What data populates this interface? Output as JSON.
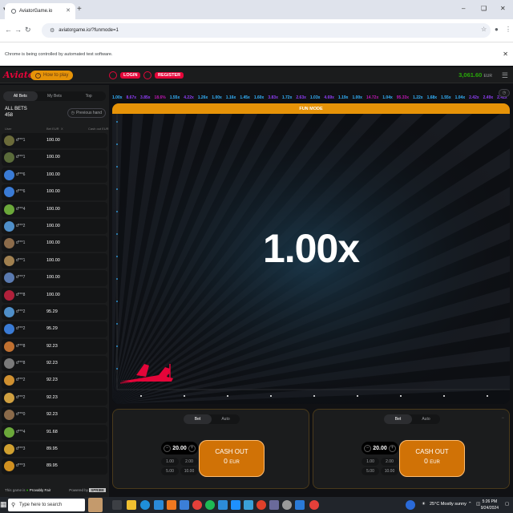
{
  "browser": {
    "tab_title": "AviatorGame.io",
    "url": "aviatorgame.io/?funmode=1",
    "automation_notice": "Chrome is being controlled by automated test software."
  },
  "header": {
    "logo": "Aviator",
    "how_to_play": "How to play",
    "login": "LOGIN",
    "register": "REGISTER",
    "balance": "3,061.60",
    "currency": "EUR"
  },
  "bets_panel": {
    "tabs": [
      "All Bets",
      "My Bets",
      "Top"
    ],
    "all_bets_label": "ALL BETS",
    "all_bets_count": "458",
    "previous_hand": "Previous hand",
    "col_user": "User",
    "col_bet": "Bet EUR",
    "col_x": "X",
    "col_cashout": "Cash out EUR",
    "rows": [
      {
        "name": "d***1",
        "amount": "100.00",
        "color": "#6b6b3a"
      },
      {
        "name": "d***1",
        "amount": "100.00",
        "color": "#5a6b3a"
      },
      {
        "name": "d***6",
        "amount": "100.00",
        "color": "#3a7bd5"
      },
      {
        "name": "d***6",
        "amount": "100.00",
        "color": "#3a7bd5"
      },
      {
        "name": "d***4",
        "amount": "100.00",
        "color": "#6ba83a"
      },
      {
        "name": "d***2",
        "amount": "100.00",
        "color": "#4f8fc9"
      },
      {
        "name": "d***1",
        "amount": "100.00",
        "color": "#8b6b4a"
      },
      {
        "name": "d***1",
        "amount": "100.00",
        "color": "#a08050"
      },
      {
        "name": "d***7",
        "amount": "100.00",
        "color": "#5a7ab0"
      },
      {
        "name": "d***8",
        "amount": "100.00",
        "color": "#b0203a"
      },
      {
        "name": "d***2",
        "amount": "95.29",
        "color": "#4f8fc9"
      },
      {
        "name": "d***2",
        "amount": "95.29",
        "color": "#3a7bd5"
      },
      {
        "name": "d***8",
        "amount": "92.23",
        "color": "#c07030"
      },
      {
        "name": "d***8",
        "amount": "92.23",
        "color": "#7a7a7a"
      },
      {
        "name": "d***2",
        "amount": "92.23",
        "color": "#d09030"
      },
      {
        "name": "d***2",
        "amount": "92.23",
        "color": "#d0a040"
      },
      {
        "name": "d***0",
        "amount": "92.23",
        "color": "#8a6a4a"
      },
      {
        "name": "d***4",
        "amount": "91.68",
        "color": "#6ba83a"
      },
      {
        "name": "d***3",
        "amount": "89.95",
        "color": "#d0a030"
      },
      {
        "name": "d***3",
        "amount": "89.95",
        "color": "#d09020"
      }
    ],
    "footer_provably": "This game is",
    "footer_provably_fair": "Provably Fair",
    "footer_powered": "Powered by",
    "footer_brand": "SPRIBE"
  },
  "history": [
    {
      "v": "1.00x",
      "c": "#34b4ff"
    },
    {
      "v": "8.67x",
      "c": "#913ef8"
    },
    {
      "v": "3.85x",
      "c": "#913ef8"
    },
    {
      "v": "18.6%",
      "c": "#c017b4"
    },
    {
      "v": "1.55x",
      "c": "#34b4ff"
    },
    {
      "v": "4.22x",
      "c": "#913ef8"
    },
    {
      "v": "1.26x",
      "c": "#34b4ff"
    },
    {
      "v": "1.00x",
      "c": "#34b4ff"
    },
    {
      "v": "1.16x",
      "c": "#34b4ff"
    },
    {
      "v": "1.45x",
      "c": "#34b4ff"
    },
    {
      "v": "1.60x",
      "c": "#34b4ff"
    },
    {
      "v": "3.83x",
      "c": "#913ef8"
    },
    {
      "v": "1.72x",
      "c": "#34b4ff"
    },
    {
      "v": "2.63x",
      "c": "#913ef8"
    },
    {
      "v": "1.03x",
      "c": "#34b4ff"
    },
    {
      "v": "4.69x",
      "c": "#913ef8"
    },
    {
      "v": "1.19x",
      "c": "#34b4ff"
    },
    {
      "v": "1.00x",
      "c": "#34b4ff"
    },
    {
      "v": "14.72x",
      "c": "#c017b4"
    },
    {
      "v": "1.04x",
      "c": "#34b4ff"
    },
    {
      "v": "95.33x",
      "c": "#c017b4"
    },
    {
      "v": "1.22x",
      "c": "#34b4ff"
    },
    {
      "v": "1.68x",
      "c": "#34b4ff"
    },
    {
      "v": "1.55x",
      "c": "#34b4ff"
    },
    {
      "v": "1.04x",
      "c": "#34b4ff"
    },
    {
      "v": "2.42x",
      "c": "#913ef8"
    },
    {
      "v": "2.49x",
      "c": "#913ef8"
    },
    {
      "v": "2.41x",
      "c": "#913ef8"
    }
  ],
  "game": {
    "fun_mode": "FUN MODE",
    "multiplier": "1.00x"
  },
  "bet_panels": [
    {
      "tab_bet": "Bet",
      "tab_auto": "Auto",
      "stake": "20.00",
      "quick": [
        "1.00",
        "2.00",
        "5.00",
        "10.00"
      ],
      "cashout_label": "CASH OUT",
      "cashout_amount": "0",
      "cashout_currency": "EUR"
    },
    {
      "tab_bet": "Bet",
      "tab_auto": "Auto",
      "stake": "20.00",
      "quick": [
        "1.00",
        "2.00",
        "5.00",
        "10.00"
      ],
      "cashout_label": "CASH OUT",
      "cashout_amount": "0",
      "cashout_currency": "EUR"
    }
  ],
  "taskbar": {
    "search_placeholder": "Type here to search",
    "weather": "25°C  Mostly sunny",
    "time": "5:26 PM",
    "date": "9/24/2024"
  },
  "colors": {
    "accent_red": "#e50539",
    "accent_orange": "#e69308",
    "balance_green": "#28a909"
  }
}
